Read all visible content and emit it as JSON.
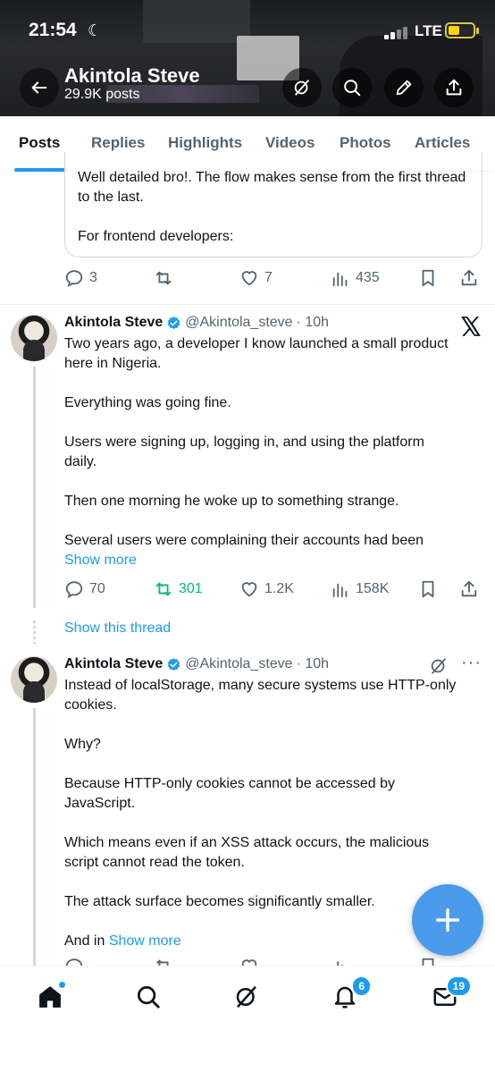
{
  "status_bar": {
    "time": "21:54",
    "network": "LTE"
  },
  "profile": {
    "name": "Akintola Steve",
    "posts": "29.9K posts"
  },
  "tabs": [
    "Posts",
    "Replies",
    "Highlights",
    "Videos",
    "Photos",
    "Articles"
  ],
  "quoted": {
    "line1": "Well detailed bro!. The flow makes sense from the first thread to the last.",
    "line2": "For frontend developers:"
  },
  "post0_actions": {
    "replies": "3",
    "likes": "7",
    "views": "435"
  },
  "post1": {
    "name": "Akintola Steve",
    "handle": "@Akintola_steve",
    "time": "· 10h",
    "paragraphs": [
      "Two years ago, a developer I know launched a small product here in Nigeria.",
      "Everything was going fine.",
      "Users were signing up, logging in, and using the platform daily.",
      "Then one morning he woke up to something strange."
    ],
    "last_paragraph": "Several users were complaining their accounts had been",
    "show_more": "Show more",
    "replies": "70",
    "reposts": "301",
    "likes": "1.2K",
    "views": "158K"
  },
  "show_thread": "Show this thread",
  "post2": {
    "name": "Akintola Steve",
    "handle": "@Akintola_steve",
    "time": "· 10h",
    "paragraphs": [
      "Instead of localStorage, many secure systems use HTTP-only cookies.",
      "Why?",
      "Because HTTP-only cookies cannot be accessed by JavaScript.",
      "Which means even if an XSS attack occurs, the malicious script cannot read the token.",
      "The attack surface becomes significantly smaller."
    ],
    "last_paragraph": "And in",
    "show_more": "Show more"
  },
  "bottom_nav": {
    "notifications_badge": "6",
    "messages_badge": "19"
  },
  "colors": {
    "accent": "#1d9bf0",
    "repost_active": "#00ba7c",
    "fab": "#4a9bea"
  }
}
